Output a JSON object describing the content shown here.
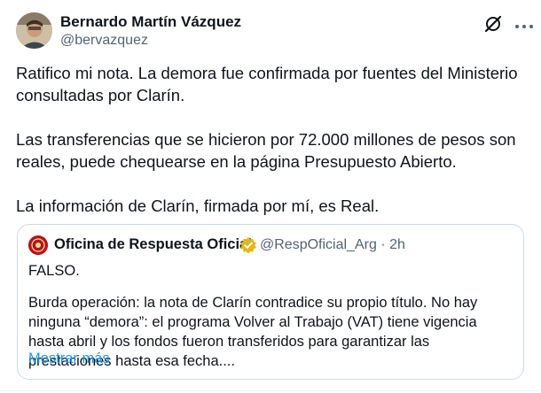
{
  "tweet": {
    "author": {
      "name": "Bernardo Martín Vázquez",
      "handle": "@bervazquez"
    },
    "paragraphs": [
      "Ratifico mi nota. La demora fue confirmada por fuentes del Ministerio consultadas por Clarín.",
      "Las transferencias que se hicieron por 72.000 millones de pesos son reales, puede chequearse en la página Presupuesto Abierto.",
      "La información de Clarín, firmada por mí,  es Real."
    ]
  },
  "quoted": {
    "name": "Oficina de Respuesta Oficial",
    "meta": "@RespOficial_Arg · 2h",
    "paragraphs": [
      "FALSO.",
      "Burda operación: la nota de Clarín contradice su propio título. No hay ninguna “demora”: el programa Volver al Trabajo (VAT) tiene vigencia hasta abril y los fondos fueron transferidos para garantizar las prestaciones hasta esa fecha...."
    ],
    "show_more": "Mostrar más"
  },
  "icons": {
    "grok": "grok-icon",
    "more": "more-horizontal-icon",
    "verified": "verified-gold-badge-icon"
  },
  "colors": {
    "link": "#1d9bf0",
    "secondary_text": "#536471",
    "border": "#cfd9de",
    "verified_gold": "#e2b719"
  }
}
